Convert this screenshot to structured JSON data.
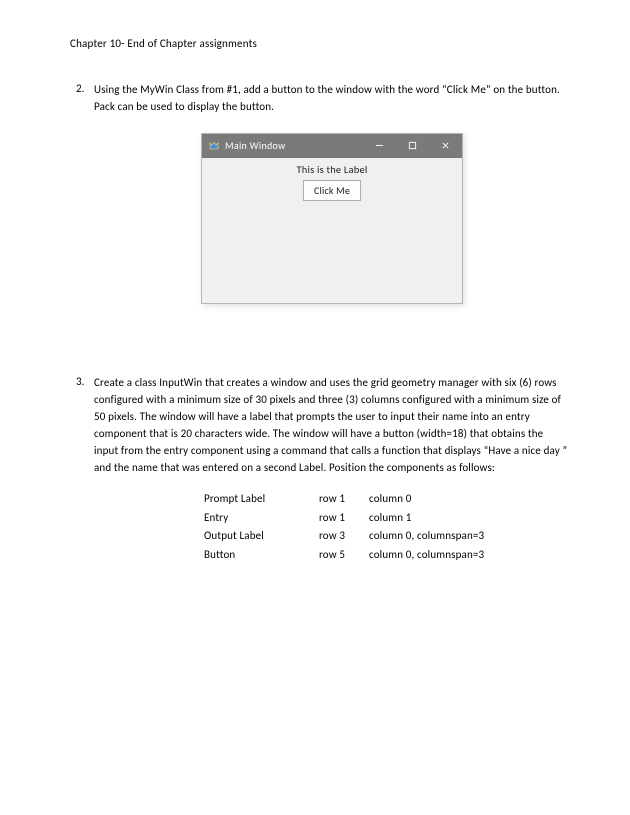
{
  "page_title": "Chapter 10- End of Chapter assignments",
  "item2": {
    "number": "2.",
    "text": "Using the MyWin Class from #1, add a button to the window with the word “Click Me” on the button.  Pack can be used to display the button."
  },
  "window": {
    "title": "Main Window",
    "label": "This is the Label",
    "button": "Click Me"
  },
  "item3": {
    "number": "3.",
    "text": "Create a class InputWin that creates a window and uses the grid geometry manager with six (6) rows configured with a minimum size of 30 pixels and three (3) columns configured with a minimum size of 50 pixels.  The window will have a label that prompts the user to input their name into an entry component that is 20 characters wide.  The window will have a button (width=18) that obtains the input from the entry component using a command that calls a function that displays “Have a nice day ” and the name that was entered on a second Label.  Position the components as follows:"
  },
  "layout": [
    {
      "label": "Prompt Label",
      "row": "row 1",
      "col": "column 0"
    },
    {
      "label": "Entry",
      "row": "row 1",
      "col": "column 1"
    },
    {
      "label": "Output Label",
      "row": "row 3",
      "col": "column 0, columnspan=3"
    },
    {
      "label": "Button",
      "row": "row 5",
      "col": "column 0, columnspan=3"
    }
  ]
}
